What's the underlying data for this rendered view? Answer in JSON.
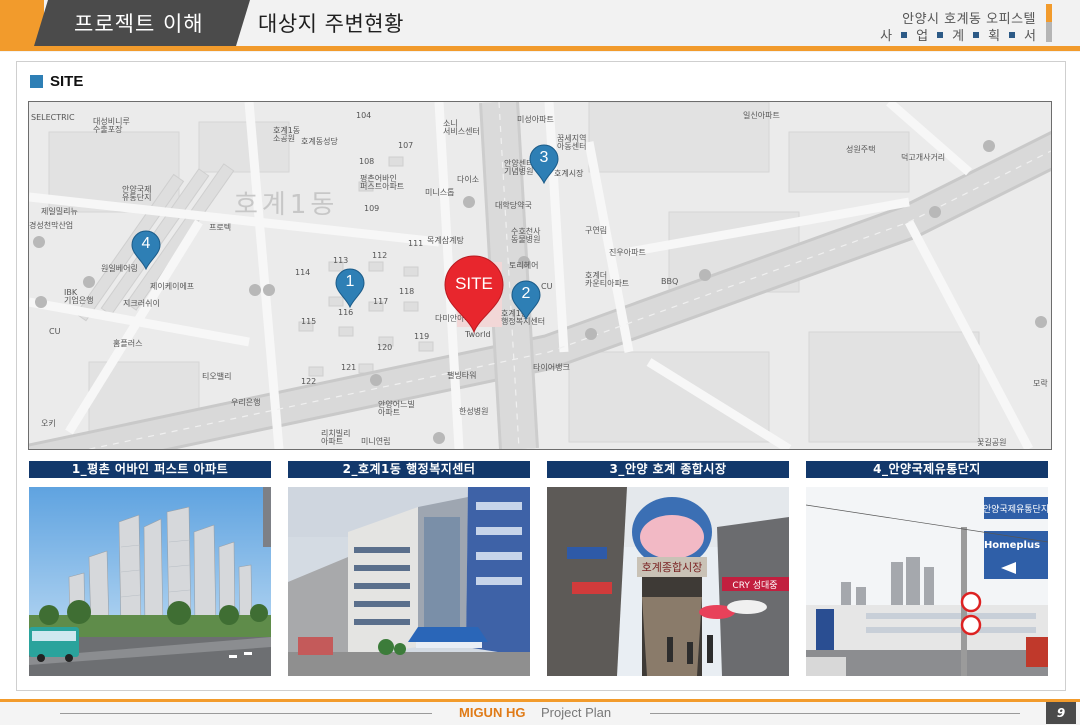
{
  "header": {
    "section_title": "프로젝트 이해",
    "page_title": "대상지 주변현황",
    "project_name": "안양시 호계동 오피스텔",
    "project_subtitle_chars": [
      "사",
      "업",
      "계",
      "획",
      "서"
    ]
  },
  "site_section": {
    "heading": "SITE",
    "icon": "blue-square-bullet-icon"
  },
  "map": {
    "district_label": "호계1동",
    "site_marker": "SITE",
    "markers": [
      "1",
      "2",
      "3",
      "4"
    ],
    "labels": {
      "selectric": "SELECTRIC",
      "apt_top_left": "대성비니루\n수출포장",
      "hogye1_hall": "호계1동\n소공원",
      "hogye_church": "호계동성당",
      "n104": "104",
      "n107": "107",
      "n108": "108",
      "n109": "109",
      "pyeongchon": "평촌어바인\n퍼스트아파트",
      "ministop": "미니스톱",
      "daiso": "다이소",
      "service_center": "소니\n서비스센터",
      "misung_apt": "미성아파트",
      "kkumsaemji": "꿈세지역\n아동센터",
      "anyang_center": "안양센터\n기념병원",
      "hogye_market": "호계시장",
      "ilsin_apt": "일신아파트",
      "sungwon": "성원주택",
      "dukgae": "덕고개사거리",
      "anyang_intl": "안양국제\n유통단지",
      "jeil_meal": "제일밀리뉴",
      "gyeongsung": "경성천막산업",
      "protect": "프로텍",
      "daehak_drug": "대학당약국",
      "suho": "수호천사\n동물병원",
      "guyeonrim": "구연림",
      "jinwoo_apt": "진우아파트",
      "mokgye": "목계삼계탕",
      "toriheo": "토리헤어",
      "cu1": "CU",
      "hogyedeo": "호계더\n카운티아파트",
      "bbq": "BBQ",
      "n113": "113",
      "n114": "114",
      "n111": "111",
      "n112": "112",
      "n115": "115",
      "n116": "116",
      "n117": "117",
      "n118": "118",
      "n119": "119",
      "n120": "120",
      "n121": "121",
      "n122": "122",
      "wonil": "원일베어링",
      "ibk": "IBK\n기업은행",
      "jaykay": "제이케이에프",
      "jigrong": "지크러쉬이",
      "cu2": "CU",
      "homeplus": "홈플러스",
      "sitebuilding": "다미안아파트",
      "tworld": "Tworld",
      "hogye_welfare": "호계1동\n행정복지센터",
      "taya": "타이어뱅크",
      "tiovalley": "티오밸리",
      "woori": "우리은행",
      "pangpang": "팰빙타워",
      "anyang_public": "안양어느빌\n아파트",
      "hansung": "한성병원",
      "richville": "리치빌리\n아파트",
      "miniyeon": "미니연립",
      "kkotgil": "꽃길공원",
      "moraechi": "모락",
      "okji": "오키"
    }
  },
  "cards": [
    {
      "title": "1_평촌 어바인 퍼스트 아파트",
      "image": "apartment-complex-photo"
    },
    {
      "title": "2_호계1동 행정복지센터",
      "image": "administrative-welfare-center-photo"
    },
    {
      "title": "3_안양 호계 종합시장",
      "image": "traditional-market-entrance-photo"
    },
    {
      "title": "4_안양국제유통단지",
      "image": "distribution-complex-street-photo"
    }
  ],
  "photo_text": {
    "market_sign": "호계종합시장",
    "market_banner": "CRY 성대중",
    "sign_road": "안양국제유통단지",
    "sign_homeplus": "Homeplus"
  },
  "footer": {
    "brand": "MIGUN HG",
    "document": "Project Plan",
    "page_number": "9"
  },
  "colors": {
    "accent_orange": "#f29b2c",
    "navy": "#12386b",
    "pin_blue": "#2e7fb5",
    "site_red": "#e8262d"
  }
}
